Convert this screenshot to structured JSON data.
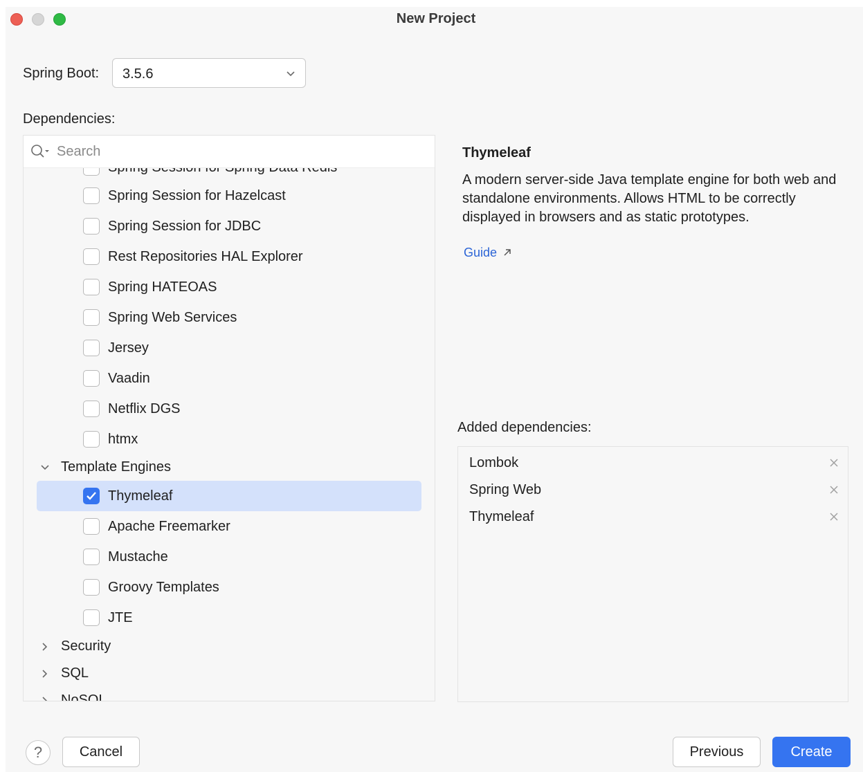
{
  "window": {
    "title": "New Project"
  },
  "spring_boot": {
    "label": "Spring Boot:",
    "value": "3.5.6"
  },
  "dependencies": {
    "label": "Dependencies:",
    "search_placeholder": "Search",
    "clipped_top_label": "Spring Session for Spring Data Redis",
    "items_above": [
      {
        "label": "Spring Session for Hazelcast",
        "checked": false
      },
      {
        "label": "Spring Session for JDBC",
        "checked": false
      },
      {
        "label": "Rest Repositories HAL Explorer",
        "checked": false
      },
      {
        "label": "Spring HATEOAS",
        "checked": false
      },
      {
        "label": "Spring Web Services",
        "checked": false
      },
      {
        "label": "Jersey",
        "checked": false
      },
      {
        "label": "Vaadin",
        "checked": false
      },
      {
        "label": "Netflix DGS",
        "checked": false
      },
      {
        "label": "htmx",
        "checked": false
      }
    ],
    "template_engines": {
      "label": "Template Engines",
      "expanded": true,
      "items": [
        {
          "label": "Thymeleaf",
          "checked": true,
          "selected": true
        },
        {
          "label": "Apache Freemarker",
          "checked": false
        },
        {
          "label": "Mustache",
          "checked": false
        },
        {
          "label": "Groovy Templates",
          "checked": false
        },
        {
          "label": "JTE",
          "checked": false
        }
      ]
    },
    "collapsed_categories": [
      "Security",
      "SQL",
      "NoSQL"
    ]
  },
  "details": {
    "title": "Thymeleaf",
    "description": "A modern server-side Java template engine for both web and standalone environments. Allows HTML to be correctly displayed in browsers and as static prototypes.",
    "guide_link": "Guide"
  },
  "added": {
    "label": "Added dependencies:",
    "items": [
      "Lombok",
      "Spring Web",
      "Thymeleaf"
    ]
  },
  "footer": {
    "help": "?",
    "cancel": "Cancel",
    "previous": "Previous",
    "create": "Create"
  },
  "colors": {
    "accent": "#3574f0",
    "selection": "#d4e1fb",
    "link": "#2b64d6"
  }
}
